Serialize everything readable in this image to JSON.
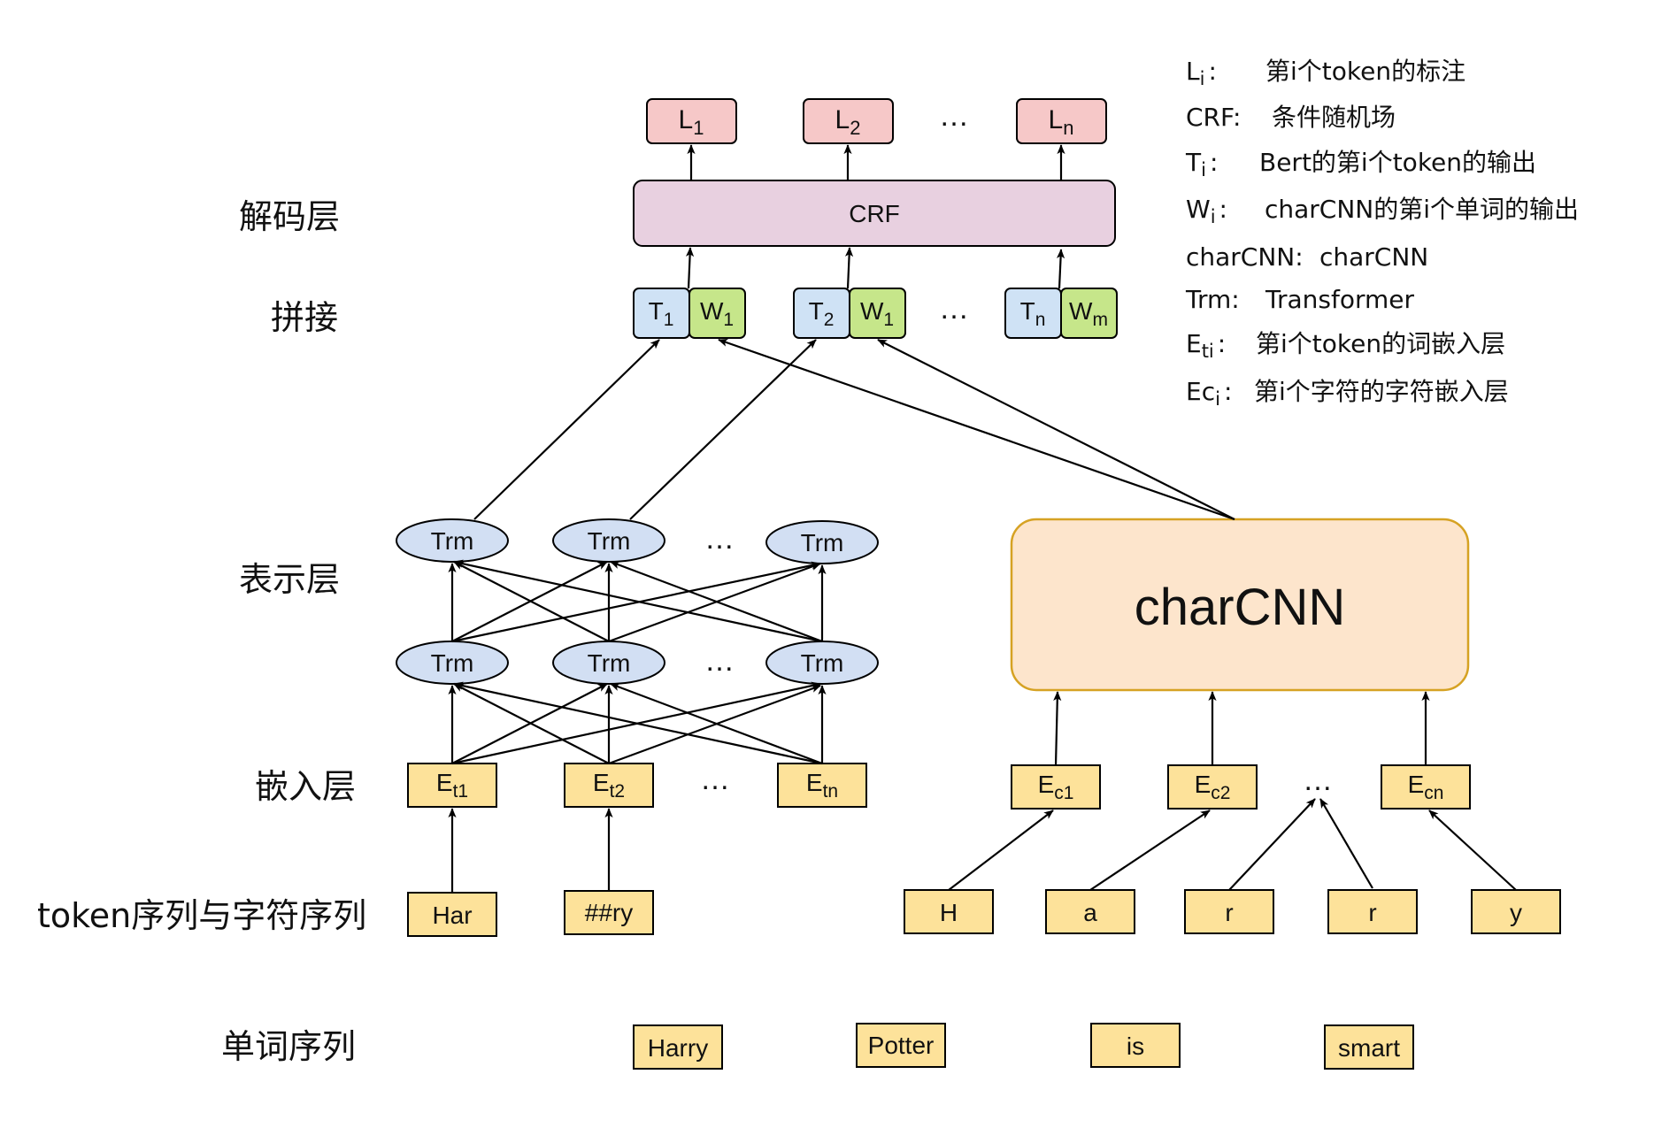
{
  "colors": {
    "yellow_fill": "#fde29a",
    "yellow_stroke": "#000000",
    "blue_fill": "#cfe2f5",
    "green_fill": "#c6e68a",
    "pink_fill": "#f6c8c8",
    "crf_fill": "#e8d0e0",
    "trm_fill": "#d2dff3",
    "charcnn_fill": "#fde5cc",
    "charcnn_stroke": "#d6a223"
  },
  "layers": {
    "decode": "解码层",
    "concat": "拼接",
    "represent": "表示层",
    "embed": "嵌入层",
    "token_char_seq": "token序列与字符序列",
    "word_seq": "单词序列"
  },
  "labels": [
    {
      "main": "L",
      "sub": "1"
    },
    {
      "main": "L",
      "sub": "2"
    },
    {
      "main": "L",
      "sub": "n"
    }
  ],
  "crf": "CRF",
  "concat_nodes": [
    {
      "t_main": "T",
      "t_sub": "1",
      "w_main": "W",
      "w_sub": "1"
    },
    {
      "t_main": "T",
      "t_sub": "2",
      "w_main": "W",
      "w_sub": "1"
    },
    {
      "t_main": "T",
      "t_sub": "n",
      "w_main": "W",
      "w_sub": "m"
    }
  ],
  "trm": "Trm",
  "charcnn": "charCNN",
  "token_embeds": [
    {
      "main": "E",
      "sub": "t1"
    },
    {
      "main": "E",
      "sub": "t2"
    },
    {
      "main": "E",
      "sub": "tn"
    }
  ],
  "char_embeds": [
    {
      "main": "E",
      "sub": "c1"
    },
    {
      "main": "E",
      "sub": "c2"
    },
    {
      "main": "E",
      "sub": "cn"
    }
  ],
  "tokens": [
    "Har",
    "##ry"
  ],
  "chars": [
    "H",
    "a",
    "r",
    "r",
    "y"
  ],
  "words": [
    "Harry",
    "Potter",
    "is",
    "smart"
  ],
  "ellipsis": "…",
  "legend": [
    {
      "key_main": "L",
      "key_sub": "i",
      "sep": ":",
      "desc": "第i个token的标注"
    },
    {
      "key_main": "CRF",
      "key_sub": "",
      "sep": ":",
      "desc": "条件随机场"
    },
    {
      "key_main": "T",
      "key_sub": "i",
      "sep": ":",
      "desc": "Bert的第i个token的输出"
    },
    {
      "key_main": "W",
      "key_sub": "i",
      "sep": ":",
      "desc": "charCNN的第i个单词的输出"
    },
    {
      "key_main": "charCNN",
      "key_sub": "",
      "sep": ":",
      "desc": "charCNN"
    },
    {
      "key_main": "Trm",
      "key_sub": "",
      "sep": ":",
      "desc": "Transformer"
    },
    {
      "key_main": "E",
      "key_sub": "ti",
      "sep": ":",
      "desc": "第i个token的词嵌入层"
    },
    {
      "key_main": "Ec",
      "key_sub": "i",
      "sep": ":",
      "desc": "第i个字符的字符嵌入层"
    }
  ]
}
